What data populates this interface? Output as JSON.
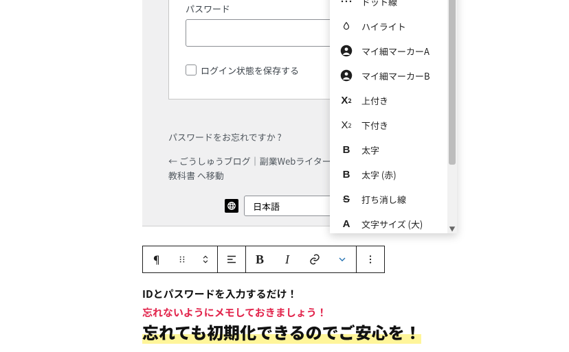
{
  "login": {
    "password_label": "パスワード",
    "password_value": "",
    "remember_label": "ログイン状態を保存する",
    "forgot": "パスワードをお忘れですか ?",
    "back_prefix": "← ",
    "back_link": "ごうしゅうブログ｜副業Webライター養成＆ブログの教科書 へ移動",
    "lang_selected": "日本語"
  },
  "dropdown": {
    "items": [
      {
        "icon": "dot",
        "label": "ドット線"
      },
      {
        "icon": "drop",
        "label": "ハイライト"
      },
      {
        "icon": "person",
        "label": "マイ細マーカーA"
      },
      {
        "icon": "person",
        "label": "マイ細マーカーB"
      },
      {
        "icon": "sup",
        "label": "上付き"
      },
      {
        "icon": "sub",
        "label": "下付き"
      },
      {
        "icon": "bold",
        "label": "太字"
      },
      {
        "icon": "bold",
        "label": "太字 (赤)"
      },
      {
        "icon": "strike",
        "label": "打ち消し線"
      },
      {
        "icon": "size",
        "label": "文字サイズ (大)"
      }
    ]
  },
  "body": {
    "line1": "IDとパスワードを入力するだけ！",
    "line2": "忘れないようにメモしておきましょう！",
    "line3": "忘れても初期化できるのでご安心を！"
  }
}
